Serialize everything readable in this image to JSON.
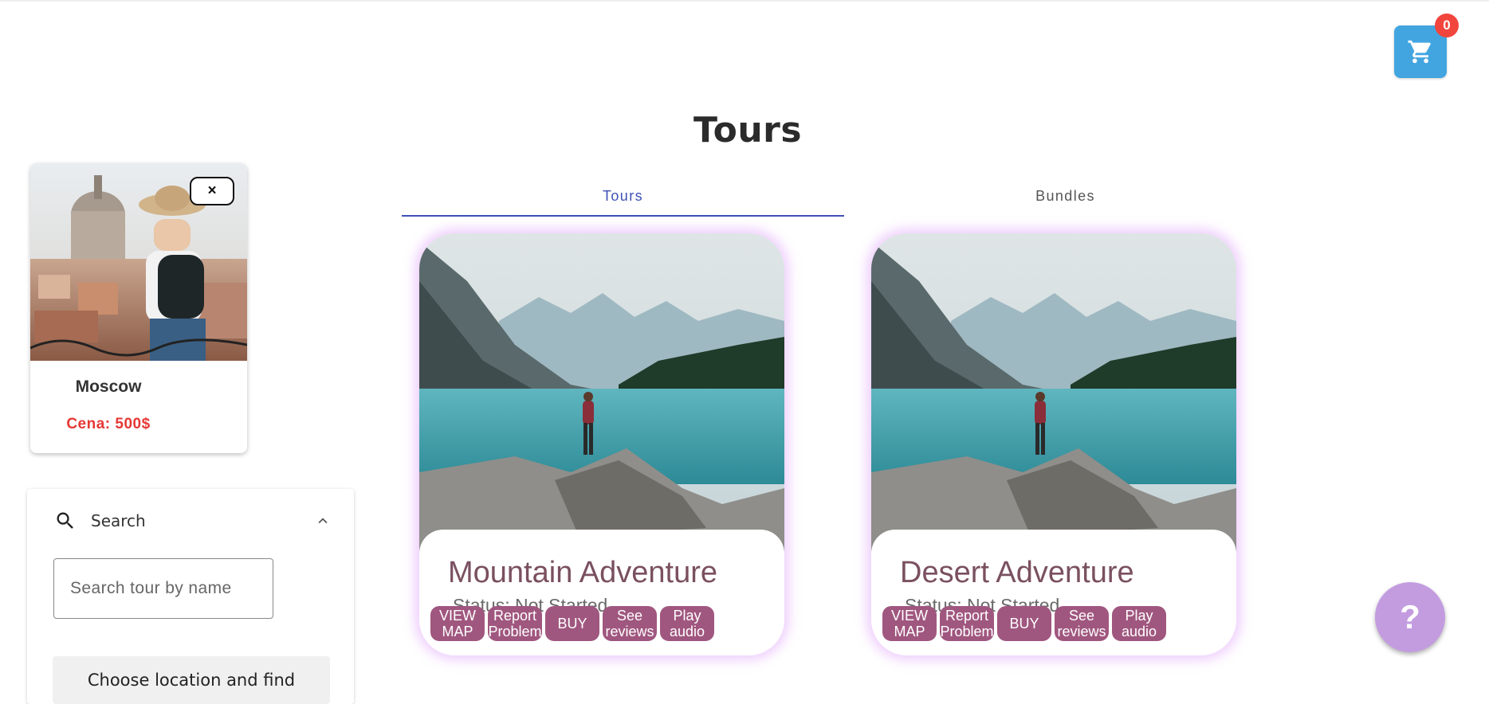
{
  "cart": {
    "count": "0",
    "icon": "shopping-cart-icon"
  },
  "page": {
    "title": "Tours"
  },
  "tabs": [
    {
      "label": "Tours",
      "active": true
    },
    {
      "label": "Bundles",
      "active": false
    }
  ],
  "selected_tour": {
    "name": "Moscow",
    "price": "Cena: 500$",
    "close_label": "×"
  },
  "search": {
    "heading": "Search",
    "placeholder": "Search tour by name",
    "choose_label": "Choose location and find"
  },
  "tours": [
    {
      "title": "Mountain Adventure",
      "status": "Status: Not Started",
      "buttons": [
        "VIEW MAP",
        "Report Problem",
        "BUY",
        "See reviews",
        "Play audio"
      ]
    },
    {
      "title": "Desert Adventure",
      "status": "Status: Not Started",
      "buttons": [
        "VIEW MAP",
        "Report Problem",
        "BUY",
        "See reviews",
        "Play audio"
      ]
    }
  ],
  "help": {
    "label": "?"
  },
  "colors": {
    "accent": "#3f51b5",
    "cart": "#42a5e0",
    "badge": "#f2453d",
    "price": "#e53935",
    "tour_button": "#a0577f",
    "help_fab": "#c39ce0"
  }
}
